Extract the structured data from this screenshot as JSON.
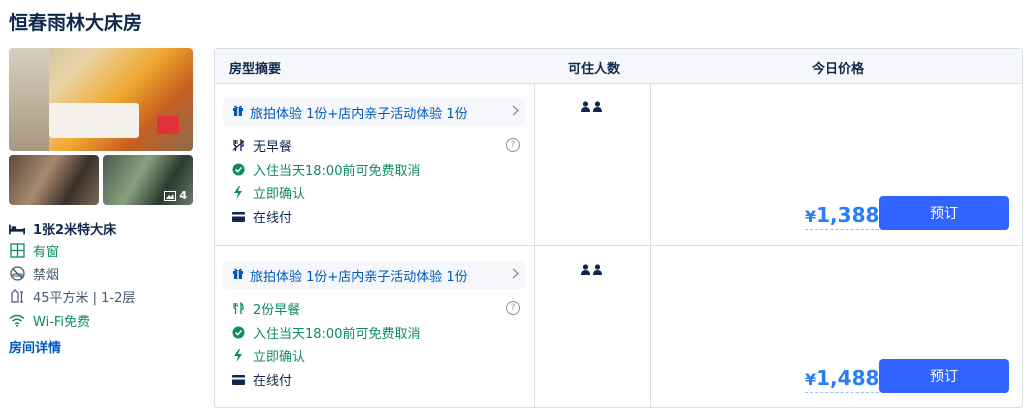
{
  "room": {
    "title": "恒春雨林大床房",
    "photo_count": "4",
    "features": {
      "bed": "1张2米特大床",
      "window": "有窗",
      "smoking": "禁烟",
      "area": "45平方米 | 1-2层",
      "wifi": "Wi-Fi免费"
    },
    "details_link": "房间详情"
  },
  "table": {
    "headers": {
      "summary": "房型摘要",
      "guests": "可住人数",
      "price": "今日价格"
    },
    "rows": [
      {
        "package": "旅拍体验 1份+店内亲子活动体验 1份",
        "meal": "无早餐",
        "cancel": "入住当天18:00前可免费取消",
        "confirm": "立即确认",
        "payment": "在线付",
        "price_currency": "¥",
        "price_value": "1,388",
        "book_label": "预订"
      },
      {
        "package": "旅拍体验 1份+店内亲子活动体验 1份",
        "meal": "2份早餐",
        "cancel": "入住当天18:00前可免费取消",
        "confirm": "立即确认",
        "payment": "在线付",
        "price_currency": "¥",
        "price_value": "1,488",
        "book_label": "预订"
      }
    ]
  },
  "colors": {
    "accent": "#3264ff",
    "price": "#287dfa",
    "green": "#0f8a64",
    "link": "#0058bb"
  }
}
